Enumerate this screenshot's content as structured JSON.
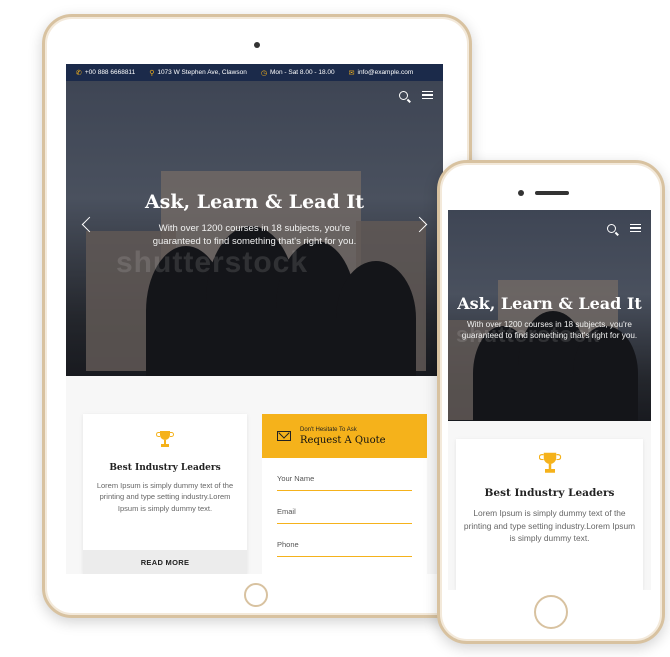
{
  "topbar": {
    "phone": "+00 888 6668811",
    "address": "1073 W Stephen Ave, Clawson",
    "hours": "Mon - Sat 8.00 - 18.00",
    "email": "info@example.com"
  },
  "hero": {
    "title": "Ask, Learn & Lead It",
    "subtitle": "With over 1200 courses in 18 subjects, you're guaranteed to find something that's right for you.",
    "watermark": "shutterstock"
  },
  "feature_card": {
    "title": "Best Industry Leaders",
    "text": "Lorem Ipsum is simply dummy text of the printing and type setting industry.Lorem Ipsum is simply dummy text.",
    "button_label": "READ MORE"
  },
  "quote_form": {
    "kicker": "Don't Hesitate To Ask",
    "title": "Request A Quote",
    "name_placeholder": "Your Name",
    "email_placeholder": "Email",
    "phone_placeholder": "Phone"
  },
  "colors": {
    "accent": "#f5b21b",
    "topbar_bg": "#1b2a4a"
  }
}
